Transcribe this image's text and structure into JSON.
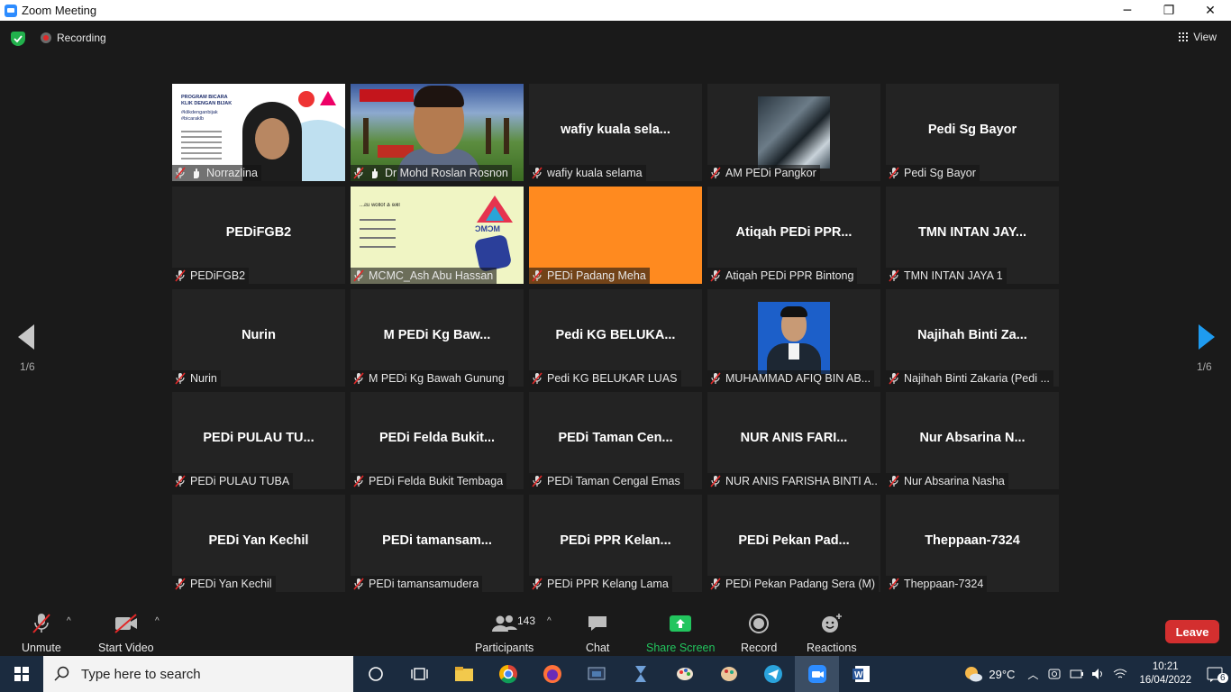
{
  "window": {
    "title": "Zoom Meeting",
    "minimize": "─",
    "maximize": "❐",
    "close": "✕"
  },
  "topbar": {
    "recording_label": "Recording",
    "view_label": "View"
  },
  "norrazlina_slide": {
    "line1": "PROGRAM BICARA",
    "line2": "KLIK DENGAN BIJAK",
    "line3": "#klikdenganbijak",
    "line4": "#bicaraklb"
  },
  "mcmc_slide": {
    "text": "like & follow us...",
    "brand": "MCMC"
  },
  "tiles": [
    {
      "big": "",
      "label": "Norrazlina",
      "kind": "norra",
      "icon": "hand"
    },
    {
      "big": "",
      "label": "Dr Mohd Roslan Rosnon",
      "kind": "roslan",
      "icon": "hand",
      "active": true
    },
    {
      "big": "wafiy kuala sela...",
      "label": "wafiy kuala selama",
      "kind": "plain"
    },
    {
      "big": "",
      "label": "AM PEDi Pangkor",
      "kind": "pangkor"
    },
    {
      "big": "Pedi Sg Bayor",
      "label": "Pedi Sg Bayor",
      "kind": "plain"
    },
    {
      "big": "PEDiFGB2",
      "label": "PEDiFGB2",
      "kind": "plain"
    },
    {
      "big": "",
      "label": "MCMC_Ash Abu Hassan",
      "kind": "mcmc"
    },
    {
      "big": "",
      "label": "PEDi Padang Meha",
      "kind": "orange"
    },
    {
      "big": "Atiqah PEDi PPR...",
      "label": "Atiqah PEDi PPR Bintong",
      "kind": "plain"
    },
    {
      "big": "TMN INTAN JAY...",
      "label": "TMN INTAN JAYA 1",
      "kind": "plain"
    },
    {
      "big": "Nurin",
      "label": "Nurin",
      "kind": "plain"
    },
    {
      "big": "M PEDi Kg Baw...",
      "label": "M PEDi Kg Bawah Gunung",
      "kind": "plain"
    },
    {
      "big": "Pedi KG BELUKA...",
      "label": "Pedi KG BELUKAR LUAS",
      "kind": "plain"
    },
    {
      "big": "",
      "label": "MUHAMMAD AFIQ BIN AB...",
      "kind": "afiq"
    },
    {
      "big": "Najihah Binti Za...",
      "label": "Najihah Binti Zakaria (Pedi ...",
      "kind": "plain"
    },
    {
      "big": "PEDi PULAU TU...",
      "label": "PEDi PULAU TUBA",
      "kind": "plain"
    },
    {
      "big": "PEDi Felda Bukit...",
      "label": "PEDi Felda Bukit Tembaga",
      "kind": "plain"
    },
    {
      "big": "PEDi Taman Cen...",
      "label": "PEDi Taman Cengal Emas",
      "kind": "plain"
    },
    {
      "big": "NUR ANIS FARI...",
      "label": "NUR ANIS FARISHA BINTI A...",
      "kind": "plain"
    },
    {
      "big": "Nur Absarina N...",
      "label": "Nur Absarina Nasha",
      "kind": "plain"
    },
    {
      "big": "PEDi Yan Kechil",
      "label": "PEDi Yan Kechil",
      "kind": "plain"
    },
    {
      "big": "PEDi tamansam...",
      "label": "PEDi tamansamudera",
      "kind": "plain"
    },
    {
      "big": "PEDi PPR Kelan...",
      "label": "PEDi PPR Kelang Lama",
      "kind": "plain"
    },
    {
      "big": "PEDi Pekan Pad...",
      "label": "PEDi Pekan Padang Sera (M)",
      "kind": "plain"
    },
    {
      "big": "Theppaan-7324",
      "label": "Theppaan-7324",
      "kind": "plain"
    }
  ],
  "paging": {
    "left": "1/6",
    "right": "1/6"
  },
  "controls": {
    "unmute": "Unmute",
    "start_video": "Start Video",
    "participants": "Participants",
    "participants_count": "143",
    "chat": "Chat",
    "share_screen": "Share Screen",
    "record": "Record",
    "reactions": "Reactions",
    "leave": "Leave",
    "share_color": "#22c55e",
    "leave_color": "#d32f2f"
  },
  "taskbar": {
    "search_placeholder": "Type here to search",
    "temperature": "29°C",
    "time": "10:21",
    "date": "16/04/2022",
    "notifications": "6"
  }
}
